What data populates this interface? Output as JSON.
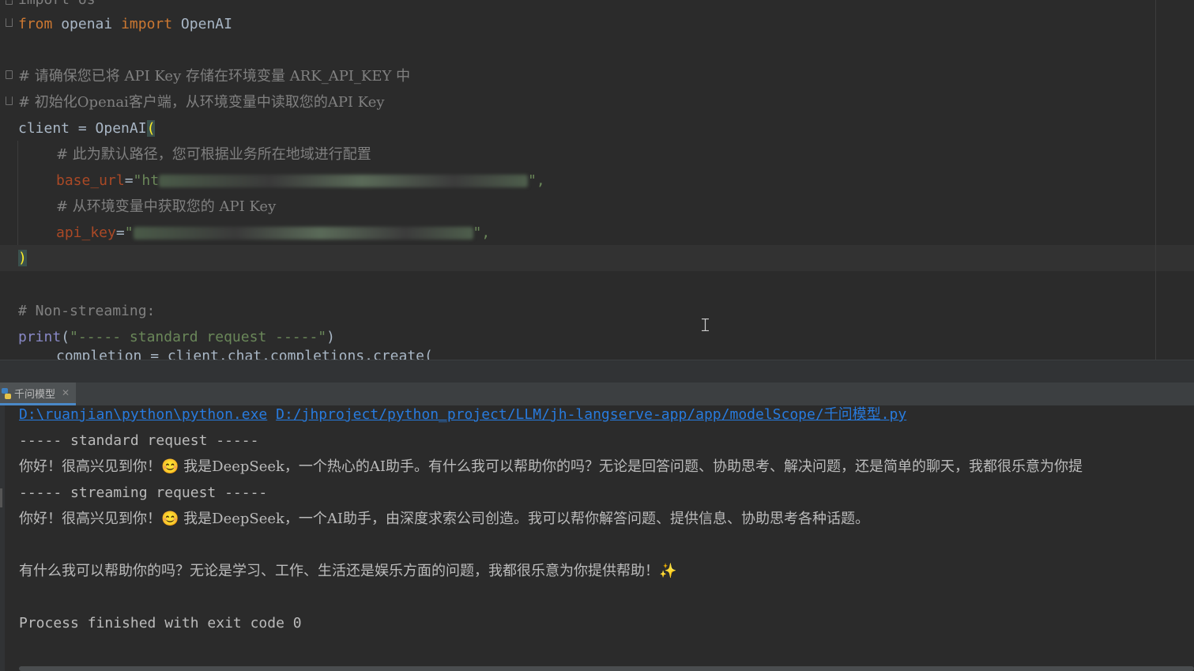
{
  "editor": {
    "lines": {
      "import_os": "import os",
      "from_kw": "from",
      "from_mod": " openai ",
      "import_kw": "import",
      "import_cls": " OpenAI",
      "comment1": "# 请确保您已将 API Key 存储在环境变量 ARK_API_KEY 中",
      "comment2": "# 初始化Openai客户端，从环境变量中读取您的API Key",
      "client_assign": "client = OpenAI",
      "open_paren": "(",
      "comment3": "# 此为默认路径，您可根据业务所在地域进行配置",
      "base_url_param": "base_url",
      "eq": "=",
      "base_url_value_prefix": "\"ht",
      "base_url_value_suffix": "\",",
      "comment4": "# 从环境变量中获取您的 API Key",
      "api_key_param": "api_key",
      "api_key_value_prefix": "\"",
      "api_key_value_suffix": "\",",
      "close_paren": ")",
      "comment5": "# Non-streaming:",
      "print_fn": "print",
      "print_open": "(",
      "print_str": "\"----- standard request -----\"",
      "print_close": ")",
      "cut_line": "completion = client.chat.completions.create("
    }
  },
  "run_panel": {
    "tab_label": "千问模型",
    "tab_icon": "python-icon",
    "close_icon": "close-icon"
  },
  "console": {
    "interpreter_path": "D:\\ruanjian\\python\\python.exe",
    "script_path": "D:/jhproject/python_project/LLM/jh-langserve-app/app/modelScope/千问模型.py",
    "std_header": "----- standard request -----",
    "std_response": "你好！很高兴见到你！😊 我是DeepSeek，一个热心的AI助手。有什么我可以帮助你的吗？无论是回答问题、协助思考、解决问题，还是简单的聊天，我都很乐意为你提",
    "stream_header": "----- streaming request -----",
    "stream_response_1": "你好！很高兴见到你！😊 我是DeepSeek，一个AI助手，由深度求索公司创造。我可以帮你解答问题、提供信息、协助思考各种话题。",
    "stream_response_2": "有什么我可以帮助你的吗？无论是学习、工作、生活还是娱乐方面的问题，我都很乐意为你提供帮助！✨",
    "exit_message": "Process finished with exit code 0"
  },
  "colors": {
    "editor_bg": "#2b2b2b",
    "keyword": "#cc7832",
    "comment": "#808080",
    "string": "#6a8759",
    "param": "#aa4926",
    "link": "#287bde"
  }
}
